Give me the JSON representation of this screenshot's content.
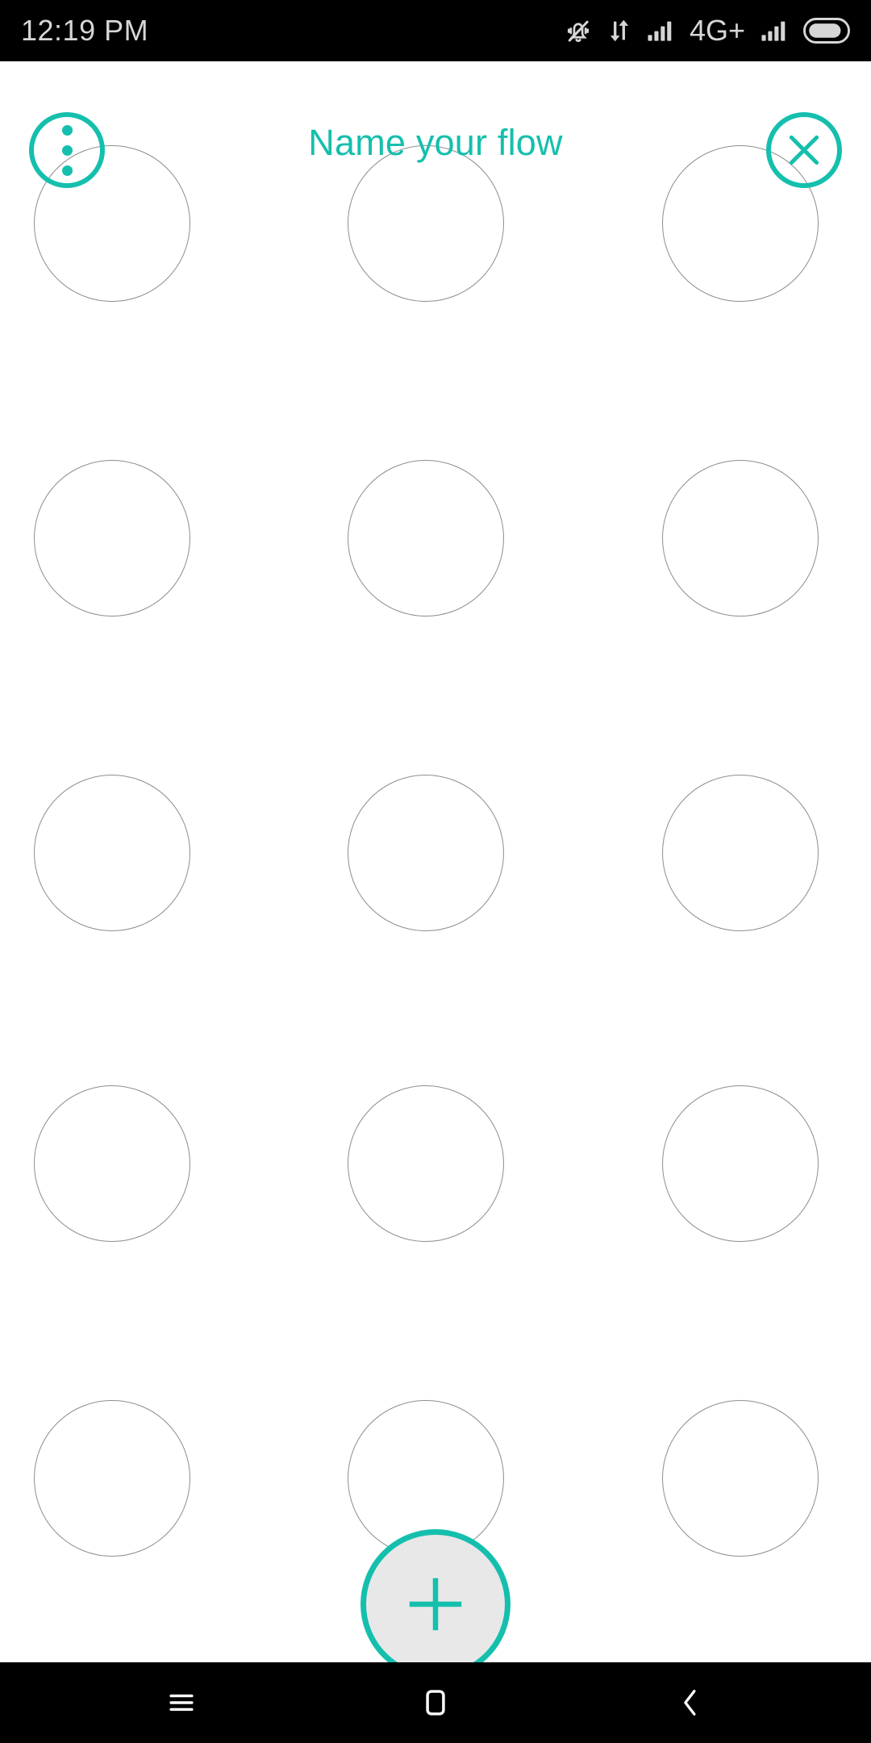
{
  "status_bar": {
    "time": "12:19 PM",
    "network_label": "4G+",
    "icons": [
      "silent-bell-icon",
      "data-transfer-icon",
      "signal-bars-sim1-icon",
      "signal-bars-sim2-icon",
      "battery-icon"
    ],
    "background_color": "#000000",
    "text_color": "#d6d6d6"
  },
  "header": {
    "title": "Name your flow",
    "accent_color": "#15bfad",
    "menu_button": {
      "name": "overflow-menu-button",
      "icon": "three-dots-vertical-icon",
      "dot_count": 3
    },
    "close_button": {
      "name": "close-button",
      "icon": "close-x-icon"
    }
  },
  "grid": {
    "columns": 3,
    "rows": 5,
    "circle_diameter": 194,
    "circle_border_color": "#8d8d8d",
    "column_centers": [
      139,
      528,
      918
    ],
    "row_centers": [
      201,
      591,
      981,
      1366,
      1756
    ],
    "slots": [
      {
        "row": 0,
        "col": 0,
        "filled": false
      },
      {
        "row": 0,
        "col": 1,
        "filled": false
      },
      {
        "row": 0,
        "col": 2,
        "filled": false
      },
      {
        "row": 1,
        "col": 0,
        "filled": false
      },
      {
        "row": 1,
        "col": 1,
        "filled": false
      },
      {
        "row": 1,
        "col": 2,
        "filled": false
      },
      {
        "row": 2,
        "col": 0,
        "filled": false
      },
      {
        "row": 2,
        "col": 1,
        "filled": false
      },
      {
        "row": 2,
        "col": 2,
        "filled": false
      },
      {
        "row": 3,
        "col": 0,
        "filled": false
      },
      {
        "row": 3,
        "col": 1,
        "filled": false
      },
      {
        "row": 3,
        "col": 2,
        "filled": false
      },
      {
        "row": 4,
        "col": 0,
        "filled": false
      },
      {
        "row": 4,
        "col": 1,
        "filled": false
      },
      {
        "row": 4,
        "col": 2,
        "filled": false
      }
    ]
  },
  "fab": {
    "name": "add-step-button",
    "icon": "plus-icon",
    "fill_color": "#e8e8e8",
    "border_color": "#15bfad"
  },
  "nav_bar": {
    "background_color": "#000000",
    "buttons": [
      {
        "name": "recents-button",
        "icon": "hamburger-menu-icon"
      },
      {
        "name": "home-button",
        "icon": "home-square-icon"
      },
      {
        "name": "back-button",
        "icon": "chevron-left-icon"
      }
    ]
  }
}
